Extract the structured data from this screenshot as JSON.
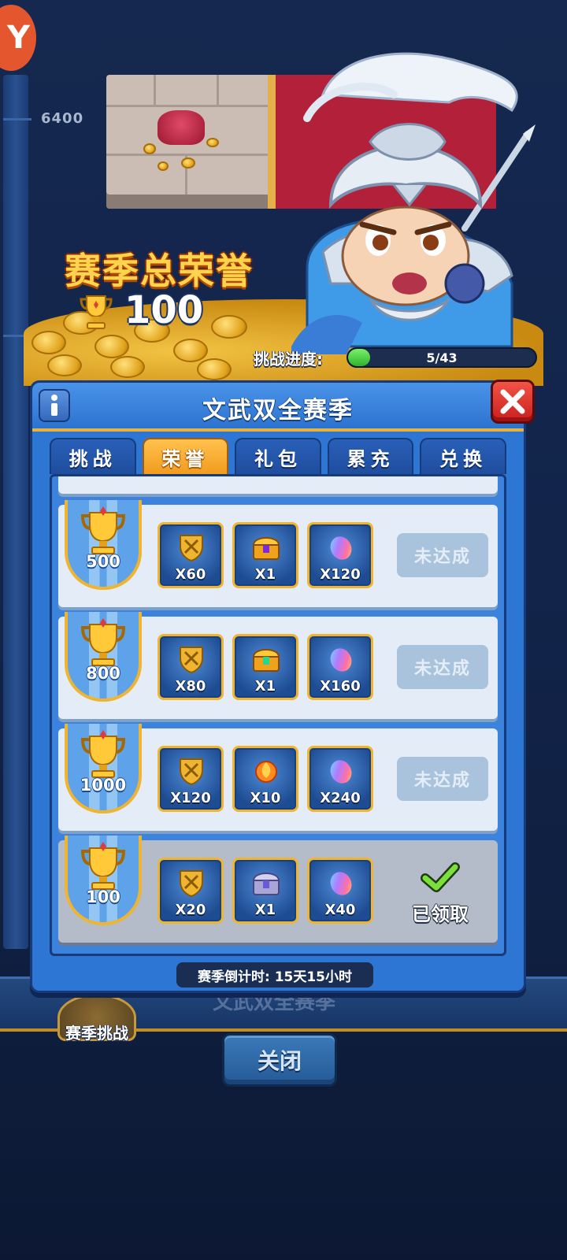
{
  "background": {
    "score_marker": "6400",
    "season_honor_title": "赛季总荣誉",
    "season_honor_value": "100",
    "challenge_progress_label": "挑战进度:",
    "challenge_progress_text": "5/43",
    "challenge_progress_fraction": 0.116,
    "behind_title": "文武双全赛季",
    "season_challenge_label": "赛季挑战",
    "close_label": "关闭"
  },
  "modal": {
    "title": "文武双全赛季",
    "tabs": [
      {
        "label": "挑战",
        "active": false
      },
      {
        "label": "荣誉",
        "active": true
      },
      {
        "label": "礼包",
        "active": false
      },
      {
        "label": "累充",
        "active": false
      },
      {
        "label": "兑换",
        "active": false
      }
    ],
    "rows": [
      {
        "threshold": "500",
        "rewards": [
          {
            "icon": "shield-swords-icon",
            "qty": "X60"
          },
          {
            "icon": "golden-chest-icon",
            "qty": "X1"
          },
          {
            "icon": "rainbow-gem-icon",
            "qty": "X120"
          }
        ],
        "status": "未达成",
        "claimed": false
      },
      {
        "threshold": "800",
        "rewards": [
          {
            "icon": "shield-swords-icon",
            "qty": "X80"
          },
          {
            "icon": "golden-chest-icon",
            "qty": "X1"
          },
          {
            "icon": "rainbow-gem-icon",
            "qty": "X160"
          }
        ],
        "status": "未达成",
        "claimed": false
      },
      {
        "threshold": "1000",
        "rewards": [
          {
            "icon": "shield-swords-icon",
            "qty": "X120"
          },
          {
            "icon": "fire-orb-icon",
            "qty": "X10"
          },
          {
            "icon": "rainbow-gem-icon",
            "qty": "X240"
          }
        ],
        "status": "未达成",
        "claimed": false
      },
      {
        "threshold": "100",
        "rewards": [
          {
            "icon": "shield-swords-icon",
            "qty": "X20"
          },
          {
            "icon": "silver-chest-icon",
            "qty": "X1"
          },
          {
            "icon": "rainbow-gem-icon",
            "qty": "X40"
          }
        ],
        "status": "已领取",
        "claimed": true
      }
    ],
    "countdown": "赛季倒计时: 15天15小时"
  },
  "colors": {
    "modal_blue": "#2e76d3",
    "tab_active": "#f29b1f",
    "gold_border": "#f0b530",
    "close_red": "#c81f1f",
    "progress_green": "#2fb22e"
  }
}
